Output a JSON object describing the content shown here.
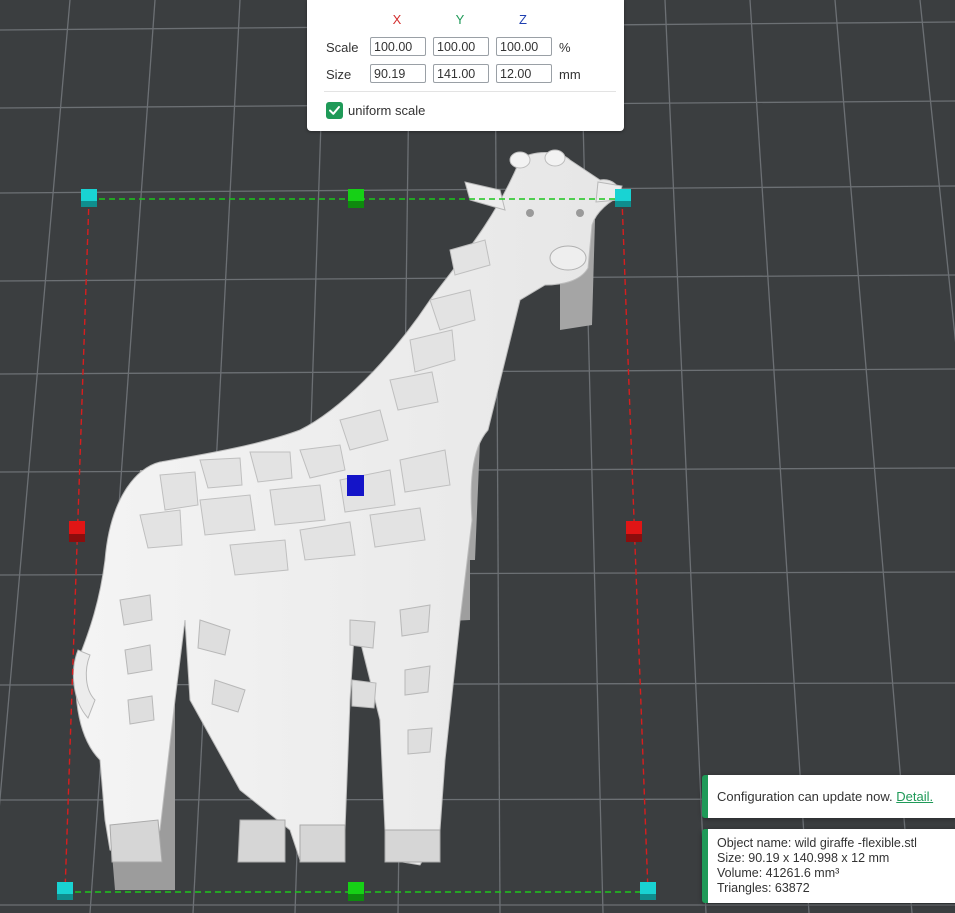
{
  "scale_panel": {
    "axis_headers": {
      "x": "X",
      "y": "Y",
      "z": "Z"
    },
    "axis_colors": {
      "x": "#d32f2f",
      "y": "#1f9a58",
      "z": "#1e3fb0"
    },
    "scale": {
      "label": "Scale",
      "x": "100.00",
      "y": "100.00",
      "z": "100.00",
      "unit": "%"
    },
    "size": {
      "label": "Size",
      "x": "90.19",
      "y": "141.00",
      "z": "12.00",
      "unit": "mm"
    },
    "uniform_scale": {
      "label": "uniform scale",
      "checked": true
    }
  },
  "notifications": {
    "update": {
      "message": "Configuration can update now.",
      "link": "Detail."
    },
    "object_info": {
      "name": "Object name: wild giraffe -flexible.stl",
      "size": "Size: 90.19 x 140.998 x 12 mm",
      "volume": "Volume: 41261.6 mm³",
      "triangles": "Triangles: 63872"
    }
  },
  "scene": {
    "object": "giraffe-model",
    "handle_colors": {
      "corner": "#19d3d3",
      "x_axis": "#e01515",
      "y_axis": "#16d016",
      "z_axis": "#1414c8"
    },
    "background": "#3b3e40",
    "grid_color": "#6c7074"
  }
}
